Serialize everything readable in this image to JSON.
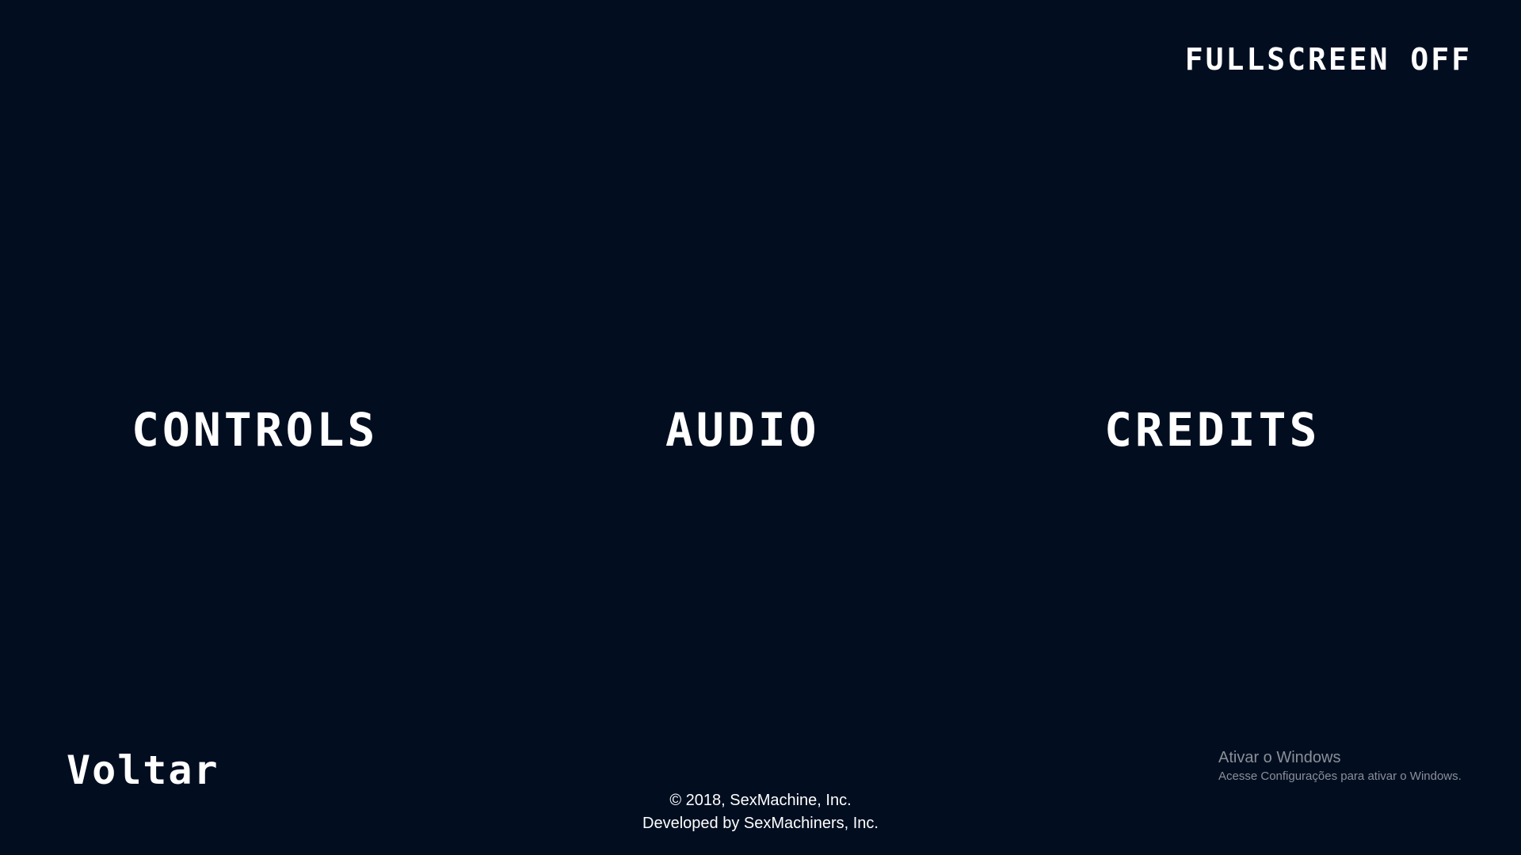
{
  "settings": {
    "fullscreen_label": "FULLSCREEN OFF"
  },
  "menu": {
    "items": [
      {
        "label": "CONTROLS"
      },
      {
        "label": "AUDIO"
      },
      {
        "label": "CREDITS"
      }
    ]
  },
  "navigation": {
    "back_label": "Voltar"
  },
  "footer": {
    "copyright": "© 2018, SexMachine, Inc.",
    "developer": "Developed by SexMachiners, Inc."
  },
  "os_watermark": {
    "title": "Ativar o Windows",
    "subtitle": "Acesse Configurações para ativar o Windows."
  },
  "colors": {
    "background": "#020e20",
    "text": "#ffffff",
    "watermark": "#8a8f98"
  }
}
